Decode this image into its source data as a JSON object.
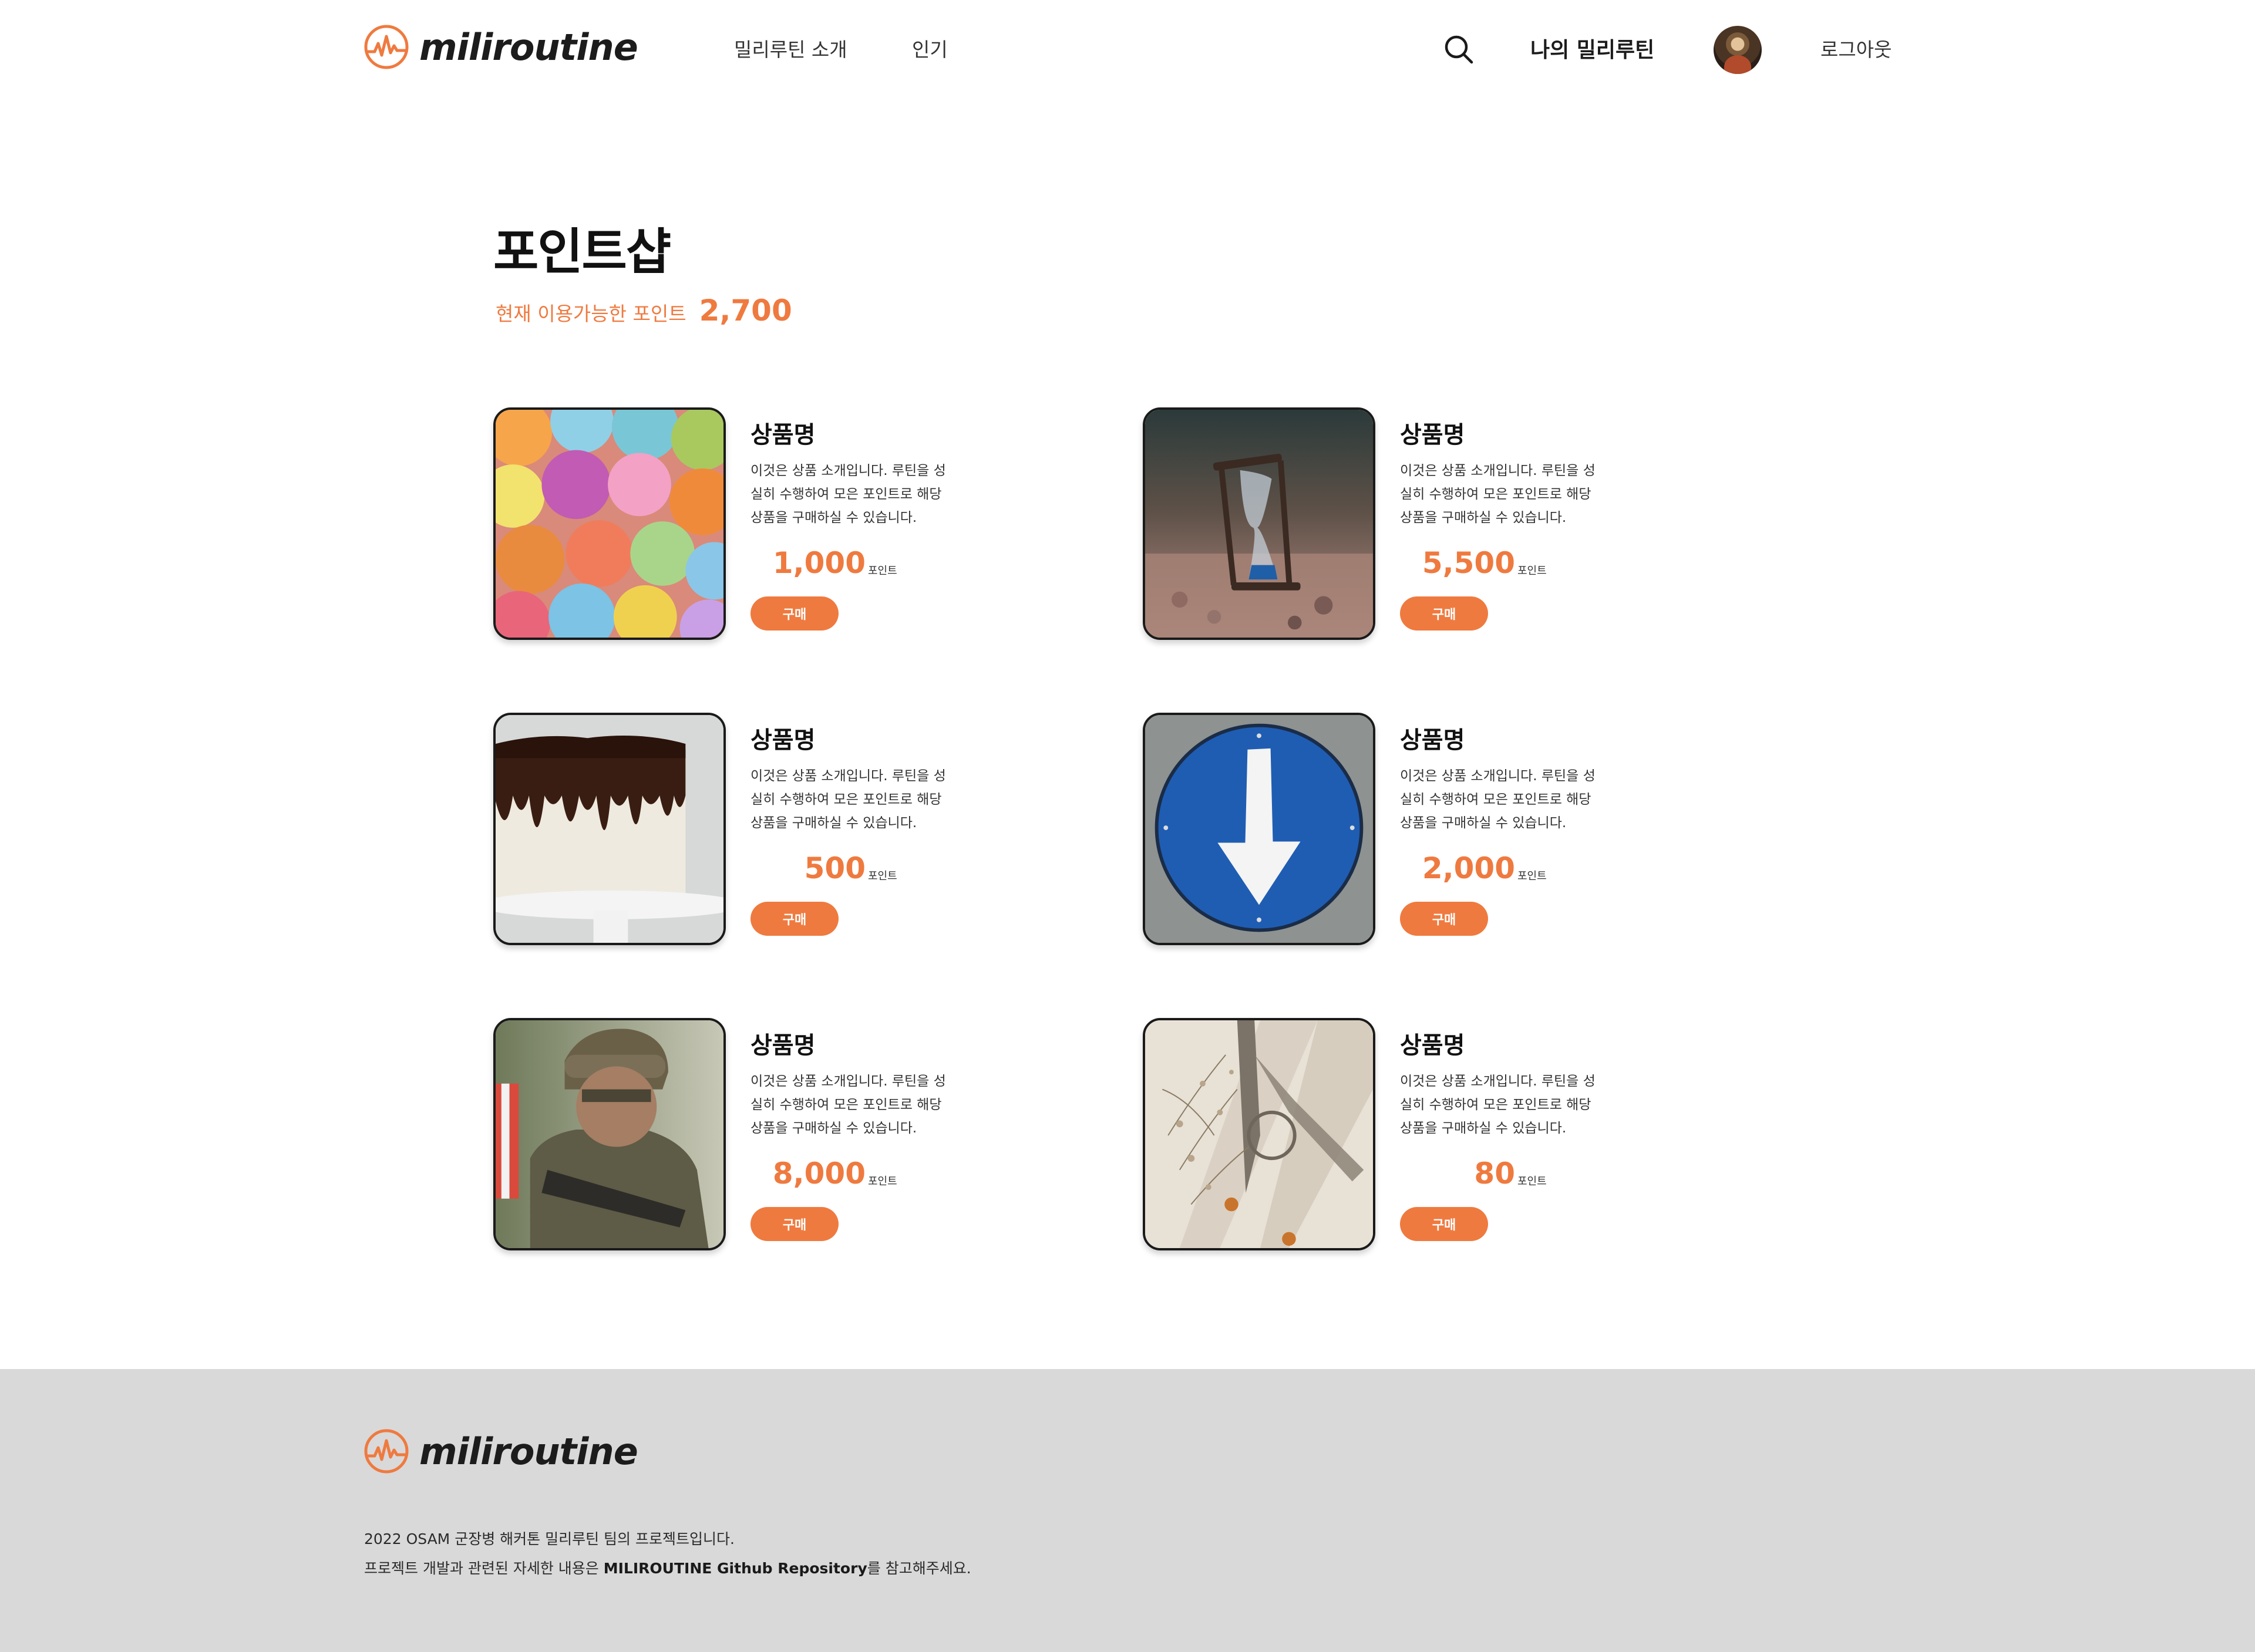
{
  "brand": {
    "name": "miliroutine",
    "accent_color": "#ef7a3f"
  },
  "header": {
    "nav": [
      "밀리루틴 소개",
      "인기"
    ],
    "my_routine": "나의 밀리루틴",
    "logout": "로그아웃"
  },
  "page": {
    "title": "포인트샵",
    "points_label": "현재 이용가능한 포인트",
    "points_value": "2,700"
  },
  "products": [
    {
      "name": "상품명",
      "desc": "이것은 상품 소개입니다. 루틴을 성실히 수행하여 모은 포인트로 해당 상품을 구매하실 수 있습니다.",
      "price": "1,000",
      "unit": "포인트",
      "button": "구매",
      "image": "macarons"
    },
    {
      "name": "상품명",
      "desc": "이것은 상품 소개입니다. 루틴을 성실히 수행하여 모은 포인트로 해당 상품을 구매하실 수 있습니다.",
      "price": "5,500",
      "unit": "포인트",
      "button": "구매",
      "image": "hourglass"
    },
    {
      "name": "상품명",
      "desc": "이것은 상품 소개입니다. 루틴을 성실히 수행하여 모은 포인트로 해당 상품을 구매하실 수 있습니다.",
      "price": "500",
      "unit": "포인트",
      "button": "구매",
      "image": "cake"
    },
    {
      "name": "상품명",
      "desc": "이것은 상품 소개입니다. 루틴을 성실히 수행하여 모은 포인트로 해당 상품을 구매하실 수 있습니다.",
      "price": "2,000",
      "unit": "포인트",
      "button": "구매",
      "image": "arrow-sign"
    },
    {
      "name": "상품명",
      "desc": "이것은 상품 소개입니다. 루틴을 성실히 수행하여 모은 포인트로 해당 상품을 구매하실 수 있습니다.",
      "price": "8,000",
      "unit": "포인트",
      "button": "구매",
      "image": "soldier"
    },
    {
      "name": "상품명",
      "desc": "이것은 상품 소개입니다. 루틴을 성실히 수행하여 모은 포인트로 해당 상품을 구매하실 수 있습니다.",
      "price": "80",
      "unit": "포인트",
      "button": "구매",
      "image": "dried-flowers"
    }
  ],
  "footer": {
    "line1": "2022 OSAM 군장병 해커톤 밀리루틴 팀의 프로젝트입니다.",
    "line2_prefix": "프로젝트 개발과 관련된 자세한 내용은 ",
    "line2_link": "MILIROUTINE Github Repository",
    "line2_suffix": "를 참고해주세요."
  }
}
